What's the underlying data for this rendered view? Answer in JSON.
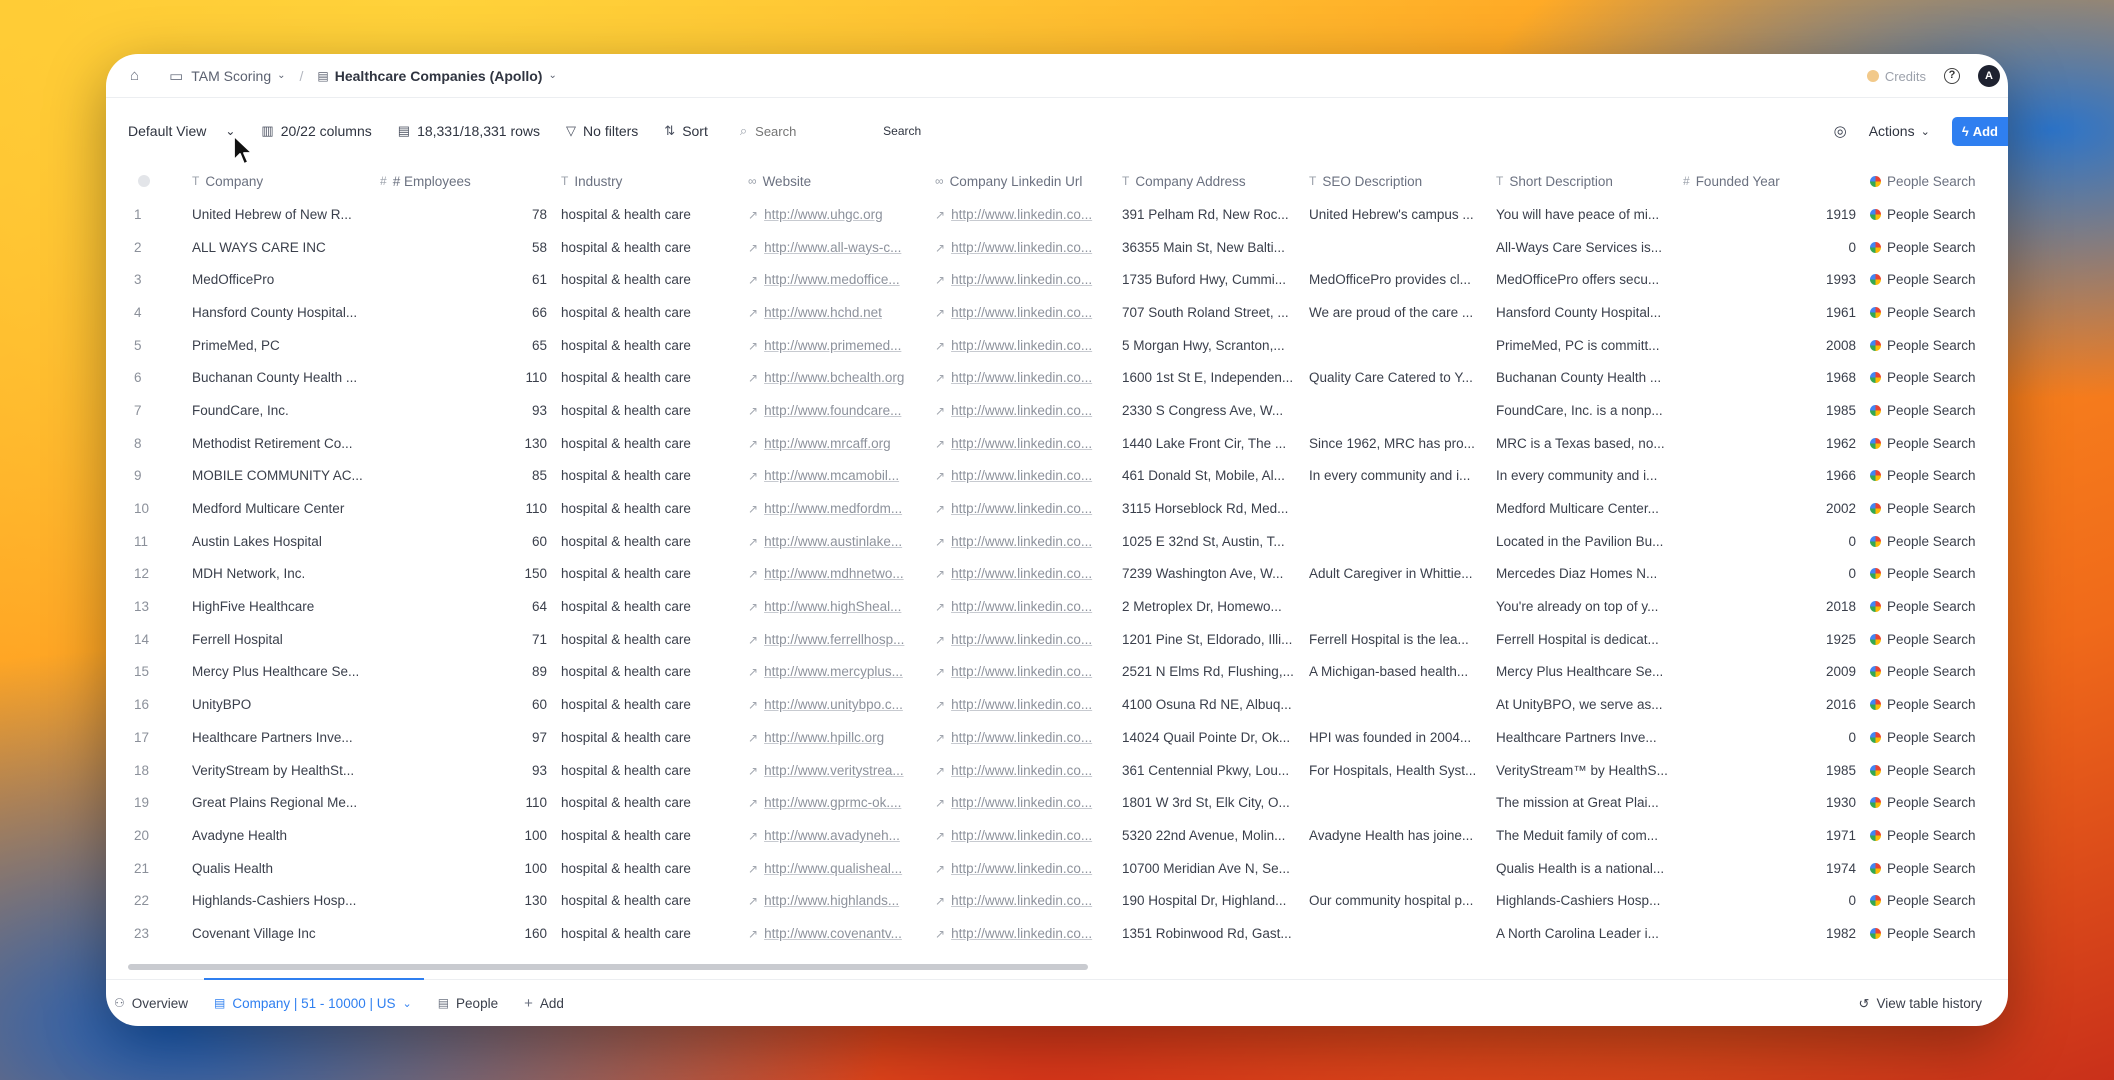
{
  "breadcrumb": {
    "folder": "TAM Scoring",
    "table": "Healthcare Companies (Apollo)"
  },
  "credits_label": "Credits",
  "avatar_initial": "A",
  "toolbar": {
    "view": "Default View",
    "columns": "20/22 columns",
    "rows": "18,331/18,331 rows",
    "filters": "No filters",
    "sort": "Sort",
    "search_placeholder": "Search",
    "search_button": "Search",
    "actions": "Actions",
    "add": "Add"
  },
  "columns": [
    "Company",
    "# Employees",
    "Industry",
    "Website",
    "Company Linkedin Url",
    "Company Address",
    "SEO Description",
    "Short Description",
    "Founded Year",
    "People Search"
  ],
  "rows": [
    [
      "1",
      "United Hebrew of New R...",
      "78",
      "hospital & health care",
      "http://www.uhgc.org",
      "http://www.linkedin.co...",
      "391 Pelham Rd, New Roc...",
      "United Hebrew's campus ...",
      "You will have peace of mi...",
      "1919",
      "People Search"
    ],
    [
      "2",
      "ALL WAYS CARE INC",
      "58",
      "hospital & health care",
      "http://www.all-ways-c...",
      "http://www.linkedin.co...",
      "36355 Main St, New Balti...",
      "",
      "All-Ways Care Services is...",
      "0",
      "People Search"
    ],
    [
      "3",
      "MedOfficePro",
      "61",
      "hospital & health care",
      "http://www.medoffice...",
      "http://www.linkedin.co...",
      "1735 Buford Hwy, Cummi...",
      "MedOfficePro provides cl...",
      "MedOfficePro offers secu...",
      "1993",
      "People Search"
    ],
    [
      "4",
      "Hansford County Hospital...",
      "66",
      "hospital & health care",
      "http://www.hchd.net",
      "http://www.linkedin.co...",
      "707 South Roland Street, ...",
      "We are proud of the care ...",
      "Hansford County Hospital...",
      "1961",
      "People Search"
    ],
    [
      "5",
      "PrimeMed, PC",
      "65",
      "hospital & health care",
      "http://www.primemed...",
      "http://www.linkedin.co...",
      "5 Morgan Hwy, Scranton,...",
      "",
      "PrimeMed, PC is committ...",
      "2008",
      "People Search"
    ],
    [
      "6",
      "Buchanan County Health ...",
      "110",
      "hospital & health care",
      "http://www.bchealth.org",
      "http://www.linkedin.co...",
      "1600 1st St E, Independen...",
      "Quality Care Catered to Y...",
      "Buchanan County Health ...",
      "1968",
      "People Search"
    ],
    [
      "7",
      "FoundCare, Inc.",
      "93",
      "hospital & health care",
      "http://www.foundcare...",
      "http://www.linkedin.co...",
      "2330 S Congress Ave, W...",
      "",
      "FoundCare, Inc. is a nonp...",
      "1985",
      "People Search"
    ],
    [
      "8",
      "Methodist Retirement Co...",
      "130",
      "hospital & health care",
      "http://www.mrcaff.org",
      "http://www.linkedin.co...",
      "1440 Lake Front Cir, The ...",
      "Since 1962, MRC has pro...",
      "MRC is a Texas based, no...",
      "1962",
      "People Search"
    ],
    [
      "9",
      "MOBILE COMMUNITY AC...",
      "85",
      "hospital & health care",
      "http://www.mcamobil...",
      "http://www.linkedin.co...",
      "461 Donald St, Mobile, Al...",
      "In every community and i...",
      "In every community and i...",
      "1966",
      "People Search"
    ],
    [
      "10",
      "Medford Multicare Center",
      "110",
      "hospital & health care",
      "http://www.medfordm...",
      "http://www.linkedin.co...",
      "3115 Horseblock Rd, Med...",
      "",
      "Medford Multicare Center...",
      "2002",
      "People Search"
    ],
    [
      "11",
      "Austin Lakes Hospital",
      "60",
      "hospital & health care",
      "http://www.austinlake...",
      "http://www.linkedin.co...",
      "1025 E 32nd St, Austin, T...",
      "",
      "Located in the Pavilion Bu...",
      "0",
      "People Search"
    ],
    [
      "12",
      "MDH Network, Inc.",
      "150",
      "hospital & health care",
      "http://www.mdhnetwo...",
      "http://www.linkedin.co...",
      "7239 Washington Ave, W...",
      "Adult Caregiver in Whittie...",
      "Mercedes Diaz Homes N...",
      "0",
      "People Search"
    ],
    [
      "13",
      "HighFive Healthcare",
      "64",
      "hospital & health care",
      "http://www.highSheal...",
      "http://www.linkedin.co...",
      "2 Metroplex Dr, Homewo...",
      "",
      "You're already on top of y...",
      "2018",
      "People Search"
    ],
    [
      "14",
      "Ferrell Hospital",
      "71",
      "hospital & health care",
      "http://www.ferrellhosp...",
      "http://www.linkedin.co...",
      "1201 Pine St, Eldorado, Illi...",
      "Ferrell Hospital is the lea...",
      "Ferrell Hospital is dedicat...",
      "1925",
      "People Search"
    ],
    [
      "15",
      "Mercy Plus Healthcare Se...",
      "89",
      "hospital & health care",
      "http://www.mercyplus...",
      "http://www.linkedin.co...",
      "2521 N Elms Rd, Flushing,...",
      "A Michigan-based health...",
      "Mercy Plus Healthcare Se...",
      "2009",
      "People Search"
    ],
    [
      "16",
      "UnityBPO",
      "60",
      "hospital & health care",
      "http://www.unitybpo.c...",
      "http://www.linkedin.co...",
      "4100 Osuna Rd NE, Albuq...",
      "",
      "At UnityBPO, we serve as...",
      "2016",
      "People Search"
    ],
    [
      "17",
      "Healthcare Partners Inve...",
      "97",
      "hospital & health care",
      "http://www.hpillc.org",
      "http://www.linkedin.co...",
      "14024 Quail Pointe Dr, Ok...",
      "HPI was founded in 2004...",
      "Healthcare Partners Inve...",
      "0",
      "People Search"
    ],
    [
      "18",
      "VerityStream by HealthSt...",
      "93",
      "hospital & health care",
      "http://www.veritystrea...",
      "http://www.linkedin.co...",
      "361 Centennial Pkwy, Lou...",
      "For Hospitals, Health Syst...",
      "VerityStream™ by HealthS...",
      "1985",
      "People Search"
    ],
    [
      "19",
      "Great Plains Regional Me...",
      "110",
      "hospital & health care",
      "http://www.gprmc-ok....",
      "http://www.linkedin.co...",
      "1801 W 3rd St, Elk City, O...",
      "",
      "The mission at Great Plai...",
      "1930",
      "People Search"
    ],
    [
      "20",
      "Avadyne Health",
      "100",
      "hospital & health care",
      "http://www.avadyneh...",
      "http://www.linkedin.co...",
      "5320 22nd Avenue, Molin...",
      "Avadyne Health has joine...",
      "The Meduit family of com...",
      "1971",
      "People Search"
    ],
    [
      "21",
      "Qualis Health",
      "100",
      "hospital & health care",
      "http://www.qualisheal...",
      "http://www.linkedin.co...",
      "10700 Meridian Ave N, Se...",
      "",
      "Qualis Health is a national...",
      "1974",
      "People Search"
    ],
    [
      "22",
      "Highlands-Cashiers Hosp...",
      "130",
      "hospital & health care",
      "http://www.highlands...",
      "http://www.linkedin.co...",
      "190 Hospital Dr, Highland...",
      "Our community hospital p...",
      "Highlands-Cashiers Hosp...",
      "0",
      "People Search"
    ],
    [
      "23",
      "Covenant Village Inc",
      "160",
      "hospital & health care",
      "http://www.covenantv...",
      "http://www.linkedin.co...",
      "1351 Robinwood Rd, Gast...",
      "",
      "A North Carolina Leader i...",
      "1982",
      "People Search"
    ]
  ],
  "footer": {
    "overview": "Overview",
    "company_tab": "Company | 51 - 10000 | US",
    "people_tab": "People",
    "add": "Add",
    "history": "View table history"
  },
  "colors": {
    "accent": "#2f7ff0"
  }
}
